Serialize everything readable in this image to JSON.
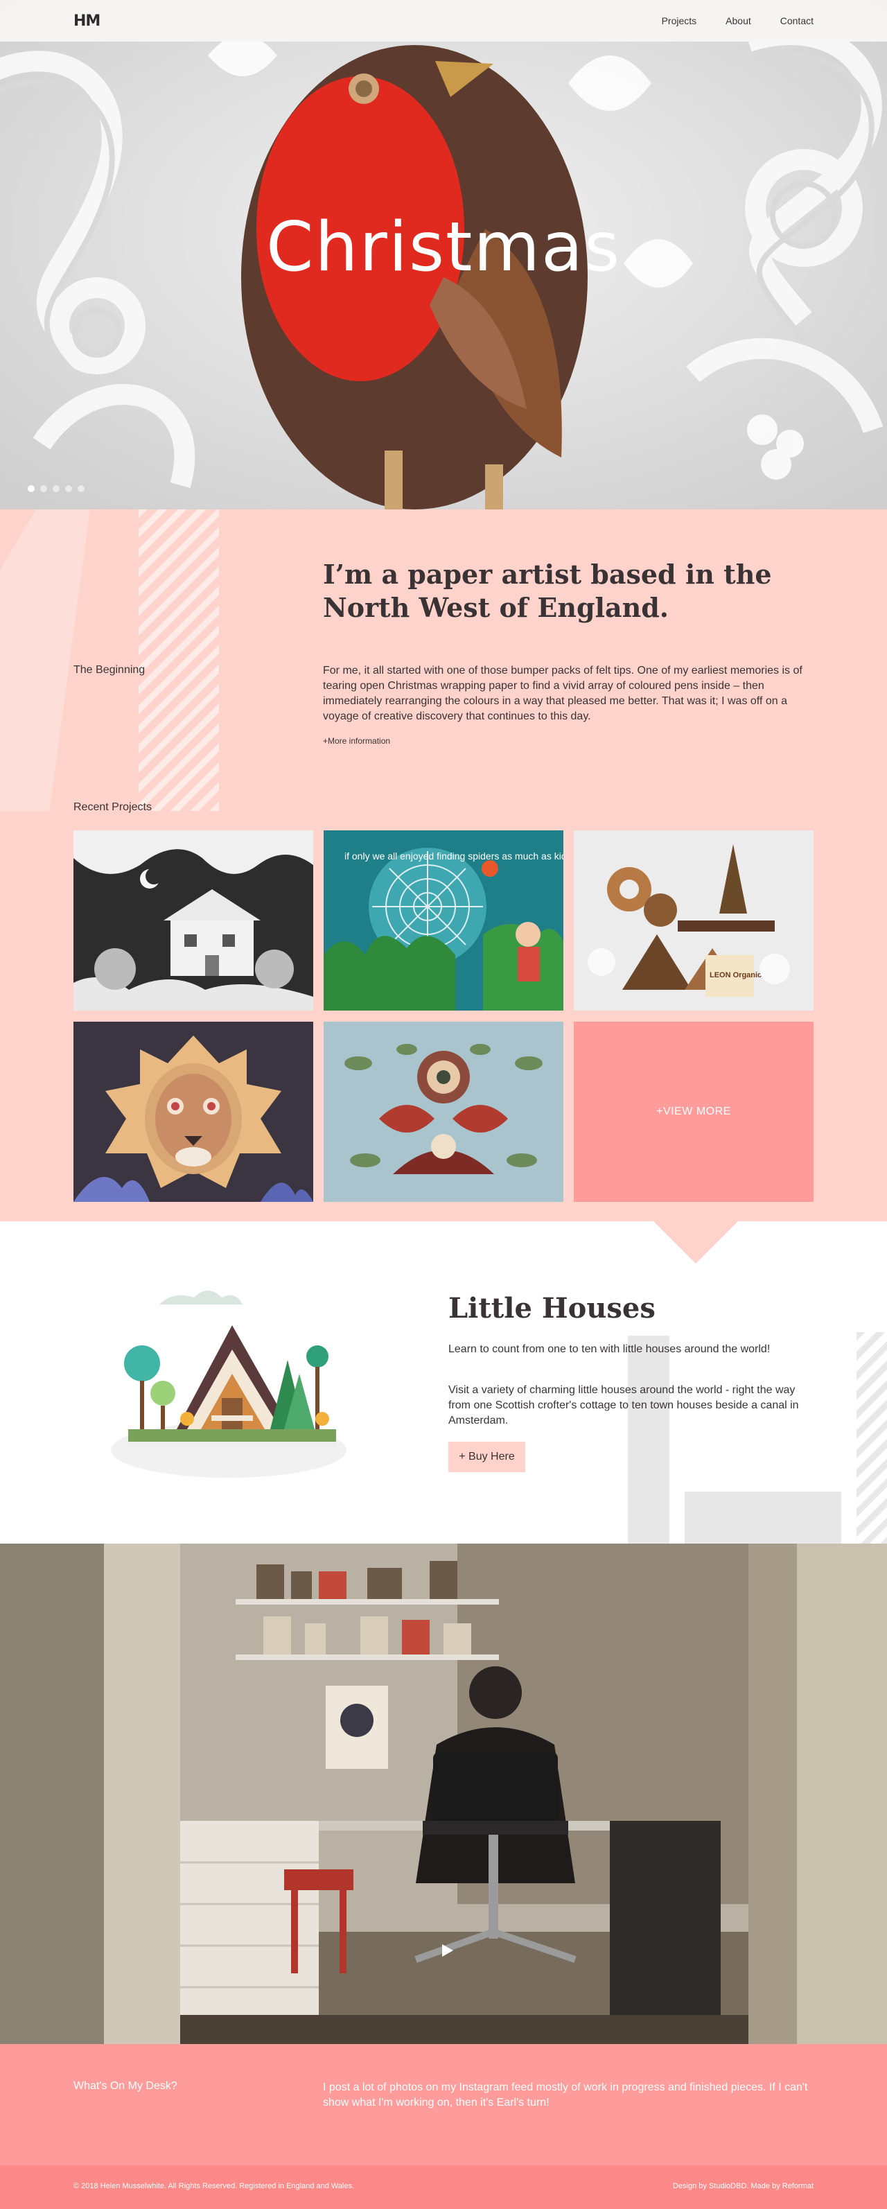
{
  "header": {
    "logo": "HM",
    "nav": [
      {
        "label": "Projects"
      },
      {
        "label": "About"
      },
      {
        "label": "Contact"
      }
    ]
  },
  "hero": {
    "title": "Christmas",
    "slides": 5,
    "active_slide": 1
  },
  "intro": {
    "heading": "I’m a paper artist based in the North West of England.",
    "side_label": "The Beginning",
    "body": "For me, it all started with one of those bumper packs of felt tips. One of my earliest memories is of tearing open Christmas wrapping paper to find a vivid array of coloured pens inside – then immediately rearranging the colours in a way that pleased me better. That was it; I was off on a voyage of creative discovery that continues to this day.",
    "more_link": "+More information"
  },
  "recent": {
    "label": "Recent Projects",
    "view_more": "+VIEW MORE",
    "tile2_text": "if only we all enjoyed finding spiders as much as kids do",
    "tile3_text": "LEON Organic Coffee"
  },
  "houses": {
    "title": "Little Houses",
    "p1": "Learn to count from one to ten with little houses around the world!",
    "p2": "Visit a variety of charming little houses around the world - right the way from one Scottish crofter's cottage to ten town houses beside a canal in Amsterdam.",
    "buy_label": "+ Buy Here"
  },
  "desk": {
    "label": "What's On My Desk?",
    "text": "I post a lot of photos on my Instagram feed mostly of work in progress and finished pieces. If I can't show what I'm working on, then it's Earl's turn!"
  },
  "footer": {
    "copyright": "© 2018 Helen Musselwhite. All Rights Reserved. Registered in England and Wales.",
    "design_prefix": "Design by ",
    "design_name": "StudioDBD",
    "made_prefix": ". Made by ",
    "made_name": "Reformat"
  },
  "colors": {
    "pink_light": "#fed3cb",
    "pink": "#fe9c9b",
    "pink_footer": "#fd8a88",
    "text": "#3a3335"
  }
}
